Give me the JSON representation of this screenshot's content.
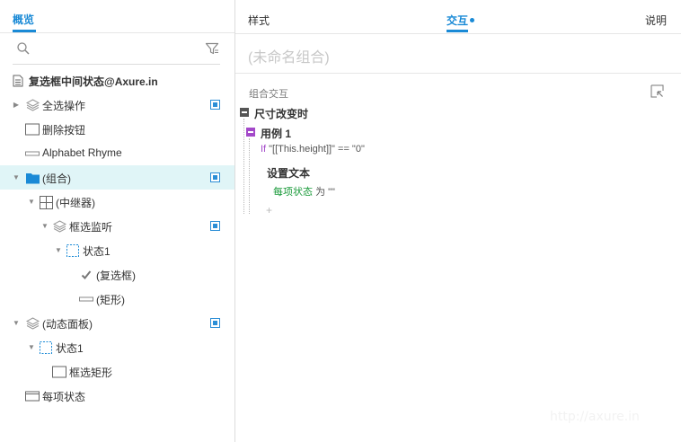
{
  "left_panel": {
    "tab_label": "概览",
    "tree": [
      {
        "label": "复选框中间状态@Axure.in",
        "icon": "page-icon",
        "bold": true,
        "checkbox": false,
        "arrow": "",
        "selected": false
      },
      {
        "label": "全选操作",
        "icon": "layers-icon",
        "bold": false,
        "checkbox": true,
        "arrow": "▶",
        "selected": false
      },
      {
        "label": "删除按钮",
        "icon": "rectangle-icon",
        "bold": false,
        "checkbox": false,
        "arrow": "",
        "selected": false
      },
      {
        "label": "Alphabet Rhyme",
        "icon": "line-icon",
        "bold": false,
        "checkbox": false,
        "arrow": "",
        "selected": false
      },
      {
        "label": "(组合)",
        "icon": "folder-icon",
        "bold": false,
        "checkbox": true,
        "arrow": "▼",
        "selected": true
      },
      {
        "label": "(中继器)",
        "icon": "grid-icon",
        "bold": false,
        "checkbox": false,
        "arrow": "▼",
        "selected": false
      },
      {
        "label": "框选监听",
        "icon": "layers-icon",
        "bold": false,
        "checkbox": true,
        "arrow": "▼",
        "selected": false
      },
      {
        "label": "状态1",
        "icon": "state-icon",
        "bold": false,
        "checkbox": false,
        "arrow": "▼",
        "selected": false
      },
      {
        "label": "(复选框)",
        "icon": "checkmark-icon",
        "bold": false,
        "checkbox": false,
        "arrow": "",
        "selected": false
      },
      {
        "label": "(矩形)",
        "icon": "line-icon",
        "bold": false,
        "checkbox": false,
        "arrow": "",
        "selected": false
      },
      {
        "label": "(动态面板)",
        "icon": "layers-icon",
        "bold": false,
        "checkbox": true,
        "arrow": "▼",
        "selected": false
      },
      {
        "label": "状态1",
        "icon": "state-icon",
        "bold": false,
        "checkbox": false,
        "arrow": "▼",
        "selected": false
      },
      {
        "label": "框选矩形",
        "icon": "rectangle-icon",
        "bold": false,
        "checkbox": false,
        "arrow": "",
        "selected": false
      },
      {
        "label": "每项状态",
        "icon": "rectangle-header-icon",
        "bold": false,
        "checkbox": false,
        "arrow": "",
        "selected": false
      }
    ]
  },
  "right_panel": {
    "tabs": {
      "style": "样式",
      "interaction": "交互",
      "notes": "说明"
    },
    "name_placeholder": "(未命名组合)",
    "section_title": "组合交互",
    "event": "尺寸改变时",
    "case": "用例 1",
    "condition_keyword": "If",
    "condition_text": "\"[[This.height]]\" == \"0\"",
    "action": "设置文本",
    "action_target": "每项状态",
    "action_value_prefix": "为",
    "action_value": "\"\"",
    "add_symbol": "+"
  },
  "colors": {
    "accent": "#1a8ad6",
    "case_purple": "#a349c9",
    "target_green": "#1a9a3a",
    "selected_row": "#e0f5f7"
  },
  "watermark": "http://axure.in"
}
